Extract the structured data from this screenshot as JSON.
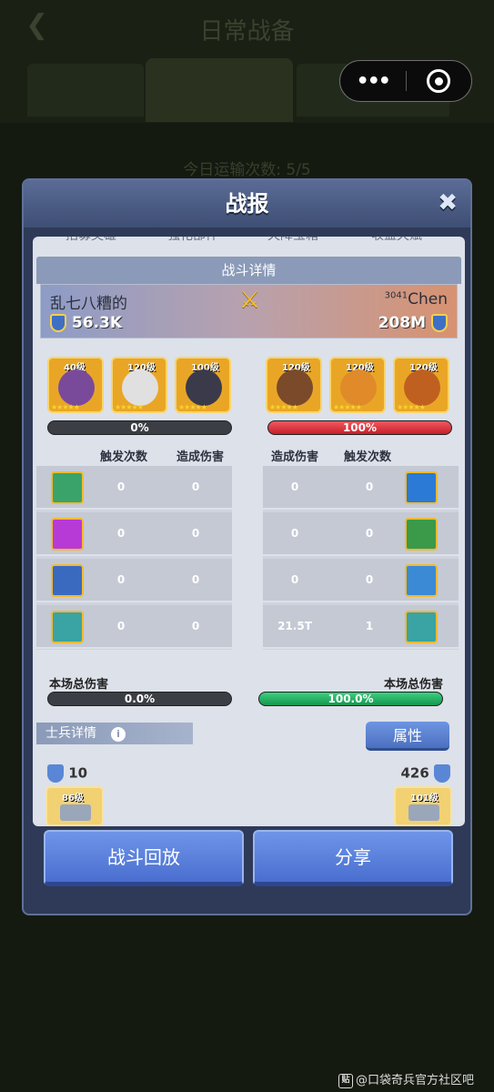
{
  "background": {
    "page_title": "日常战备",
    "back_glyph": "❮",
    "tabs": [
      "",
      "",
      ""
    ],
    "transport_count": "今日运输次数: 5/5"
  },
  "capsule": {
    "more_glyph": "•••"
  },
  "dialog": {
    "title": "战报",
    "close_glyph": "✖",
    "cut_tabs": [
      "招募英雄",
      "强化部件",
      "天降宝箱",
      "收益天赋"
    ],
    "battle_detail_header": "战斗详情",
    "left_player": {
      "name": "乱七八糟的",
      "power": "56.3K"
    },
    "right_player": {
      "name_prefix": "3041",
      "name": "Chen",
      "power": "208M"
    },
    "left_heroes": [
      {
        "level": "40级",
        "color": "#7a4a9a"
      },
      {
        "level": "120级",
        "color": "#e0e0e0"
      },
      {
        "level": "100级",
        "color": "#3a3a4a"
      }
    ],
    "right_heroes": [
      {
        "level": "120级",
        "color": "#7a4a2a"
      },
      {
        "level": "120级",
        "color": "#e08a2a"
      },
      {
        "level": "120级",
        "color": "#c06020"
      }
    ],
    "left_progress": {
      "label": "0%",
      "value": 0
    },
    "right_progress": {
      "label": "100%",
      "value": 1
    },
    "left_headers": {
      "triggers": "触发次数",
      "damage": "造成伤害"
    },
    "right_headers": {
      "damage": "造成伤害",
      "triggers": "触发次数"
    },
    "left_skills": [
      {
        "icon": "green-hero-skill-icon",
        "color": "#3aa36a",
        "triggers": "0",
        "damage": "0"
      },
      {
        "icon": "purple-lightning-skill-icon",
        "color": "#b83ad6",
        "triggers": "0",
        "damage": "0"
      },
      {
        "icon": "crosshair-skill-icon",
        "color": "#3a6ac0",
        "triggers": "0",
        "damage": "0"
      },
      {
        "icon": "missile-skill-icon",
        "color": "#3aa3a3",
        "triggers": "0",
        "damage": "0"
      }
    ],
    "right_skills": [
      {
        "icon": "ice-blast-skill-icon",
        "color": "#2a7ad6",
        "damage": "0",
        "triggers": "0"
      },
      {
        "icon": "heart-shield-skill-icon",
        "color": "#3a9a4a",
        "damage": "0",
        "triggers": "0"
      },
      {
        "icon": "ice-shard-skill-icon",
        "color": "#3a8ad6",
        "damage": "0",
        "triggers": "0"
      },
      {
        "icon": "missile-skill-icon",
        "color": "#3aa3a3",
        "damage": "21.5T",
        "triggers": "1"
      }
    ],
    "left_total": {
      "label": "本场总伤害",
      "value_text": "0.0%",
      "value": 0
    },
    "right_total": {
      "label": "本场总伤害",
      "value_text": "100.0%",
      "value": 1
    },
    "soldier_detail": "士兵详情",
    "info_glyph": "i",
    "attributes_button": "属性",
    "left_soldier_count": "10",
    "right_soldier_count": "426",
    "left_unit_level": "86级",
    "right_unit_level": "101级",
    "replay_button": "战斗回放",
    "share_button": "分享"
  },
  "watermark": {
    "badge": "贴",
    "text": "@口袋奇兵官方社区吧"
  },
  "colors": {
    "dialog_bg": "#2e3a57",
    "button_blue": "#5a82dc",
    "enemy_red": "#e02f3a",
    "total_green": "#1fae62"
  }
}
